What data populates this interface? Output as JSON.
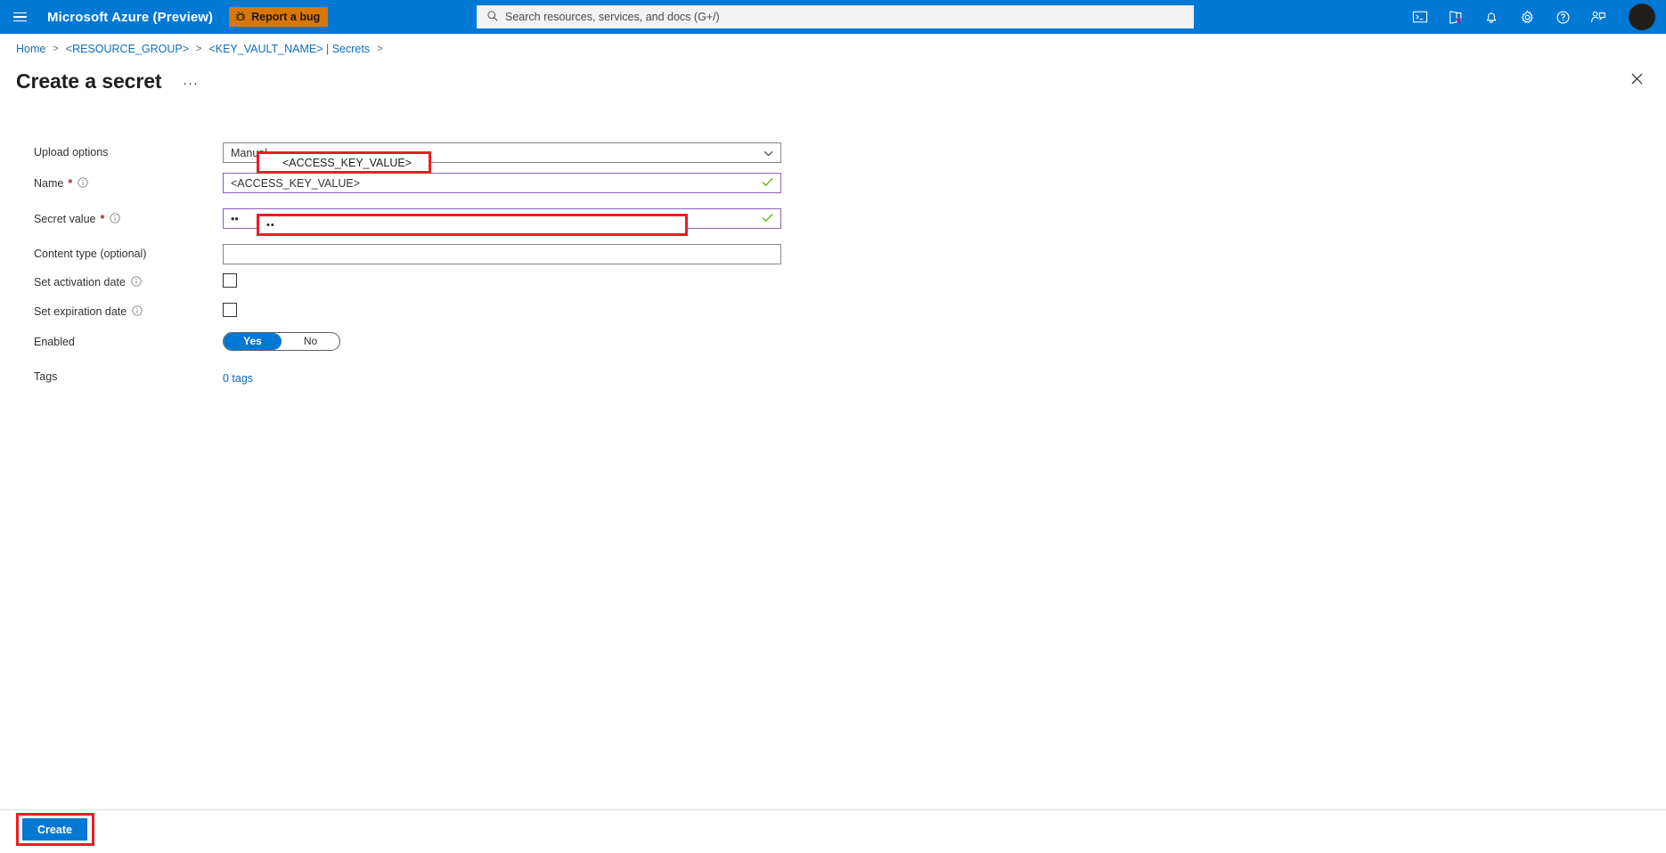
{
  "topbar": {
    "menu_icon": "hamburger-icon",
    "brand": "Microsoft Azure (Preview)",
    "report_bug_label": "Report a bug",
    "report_bug_icon": "bug-icon",
    "report_bug_color": "#d97706",
    "bar_color": "#0078d4",
    "search": {
      "placeholder": "Search resources, services, and docs (G+/)",
      "value": "",
      "icon": "search-icon"
    },
    "icons": [
      {
        "name": "cloud-shell-icon"
      },
      {
        "name": "directory-filter-icon"
      },
      {
        "name": "notifications-bell-icon"
      },
      {
        "name": "settings-gear-icon"
      },
      {
        "name": "help-question-icon"
      },
      {
        "name": "feedback-person-icon"
      }
    ],
    "avatar": {
      "name": "user-avatar",
      "color": "#201f1e"
    }
  },
  "breadcrumb": {
    "items": [
      "Home",
      "<RESOURCE_GROUP>",
      "<KEY_VAULT_NAME> | Secrets"
    ],
    "separator": ">",
    "trailing_separator": ">"
  },
  "page": {
    "title": "Create a secret",
    "ellipsis": "···",
    "close_icon": "close-icon"
  },
  "form": {
    "upload_options": {
      "label": "Upload options",
      "value": "Manual",
      "chevron_icon": "chevron-down-icon"
    },
    "name": {
      "label": "Name",
      "required": "*",
      "info_icon": "info-icon",
      "value": "<ACCESS_KEY_VALUE>",
      "validated": true,
      "check_icon": "green-check-icon"
    },
    "secret_value": {
      "label": "Secret value",
      "required": "*",
      "info_icon": "info-icon",
      "value": "••",
      "validated": true,
      "check_icon": "green-check-icon"
    },
    "content_type": {
      "label": "Content type (optional)",
      "value": "",
      "placeholder": ""
    },
    "set_activation_date": {
      "label": "Set activation date",
      "info_icon": "info-icon",
      "checked": false
    },
    "set_expiration_date": {
      "label": "Set expiration date",
      "info_icon": "info-icon",
      "checked": false
    },
    "enabled": {
      "label": "Enabled",
      "yes_label": "Yes",
      "no_label": "No",
      "selected": "Yes"
    },
    "tags": {
      "label": "Tags",
      "value": "0 tags"
    }
  },
  "footer": {
    "create_label": "Create"
  },
  "annotations": {
    "color": "#ed1c24",
    "boxes": [
      {
        "name": "name-field-highlight",
        "text": "<ACCESS_KEY_VALUE>"
      },
      {
        "name": "secret-value-field-highlight",
        "text": "••"
      },
      {
        "name": "create-button-highlight",
        "text": ""
      }
    ]
  }
}
